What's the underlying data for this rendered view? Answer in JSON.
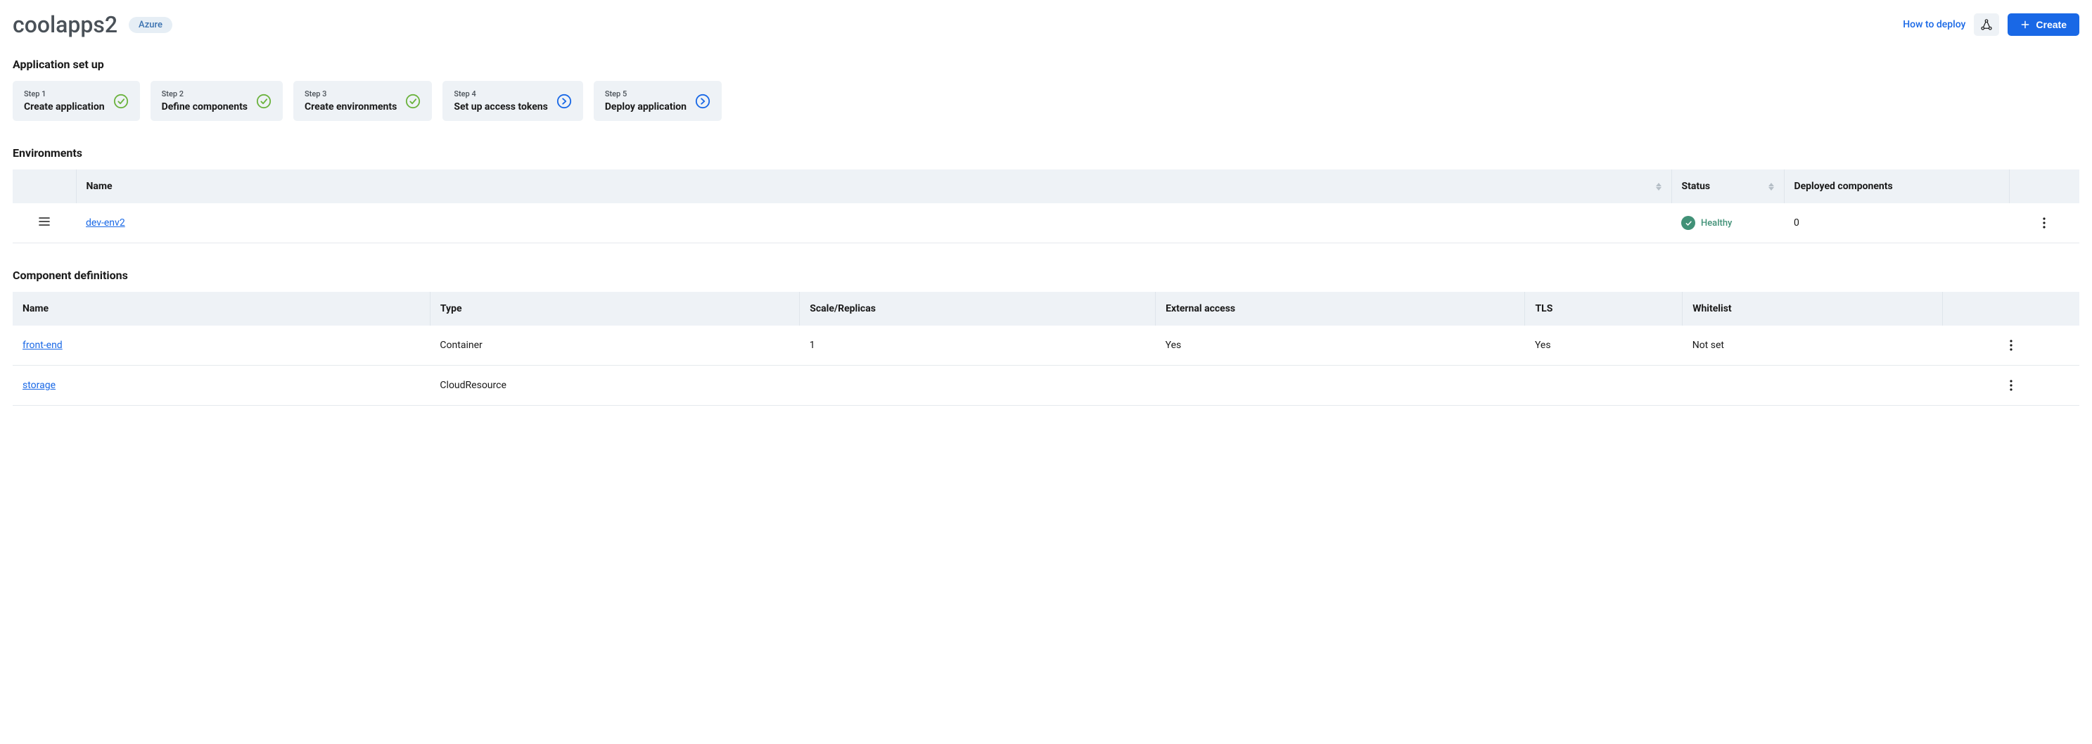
{
  "header": {
    "app_name": "coolapps2",
    "badge": "Azure",
    "how_to_deploy": "How to deploy",
    "create_label": "Create"
  },
  "setup": {
    "title": "Application set up",
    "steps": [
      {
        "number": "Step 1",
        "label": "Create application",
        "status": "done"
      },
      {
        "number": "Step 2",
        "label": "Define components",
        "status": "done"
      },
      {
        "number": "Step 3",
        "label": "Create environments",
        "status": "done"
      },
      {
        "number": "Step 4",
        "label": "Set up access tokens",
        "status": "pending"
      },
      {
        "number": "Step 5",
        "label": "Deploy application",
        "status": "pending"
      }
    ]
  },
  "environments": {
    "title": "Environments",
    "columns": {
      "name": "Name",
      "status": "Status",
      "deployed": "Deployed components"
    },
    "rows": [
      {
        "name": "dev-env2",
        "status_label": "Healthy",
        "deployed": "0"
      }
    ]
  },
  "components": {
    "title": "Component definitions",
    "columns": {
      "name": "Name",
      "type": "Type",
      "scale": "Scale/Replicas",
      "external": "External access",
      "tls": "TLS",
      "whitelist": "Whitelist"
    },
    "rows": [
      {
        "name": "front-end",
        "type": "Container",
        "scale": "1",
        "external": "Yes",
        "tls": "Yes",
        "whitelist": "Not set"
      },
      {
        "name": "storage",
        "type": "CloudResource",
        "scale": "",
        "external": "",
        "tls": "",
        "whitelist": ""
      }
    ]
  }
}
